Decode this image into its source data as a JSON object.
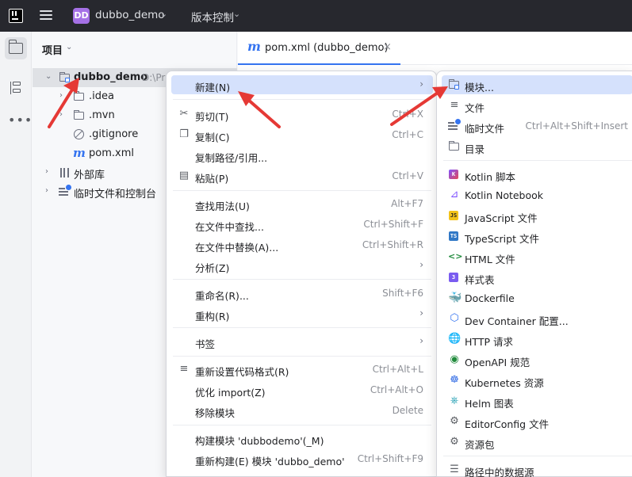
{
  "titlebar": {
    "project_badge": "DD",
    "project_name": "dubbo_demo",
    "vcs_label": "版本控制"
  },
  "project_panel": {
    "title": "项目",
    "tree": [
      {
        "label": "dubbo_demo",
        "hint": "D:\\Pr",
        "icon": "module-folder-icon",
        "expanded": true,
        "selected": true
      },
      {
        "label": ".idea",
        "icon": "folder-icon"
      },
      {
        "label": ".mvn",
        "icon": "folder-icon"
      },
      {
        "label": ".gitignore",
        "icon": "ignored-file-icon"
      },
      {
        "label": "pom.xml",
        "icon": "maven-icon"
      },
      {
        "label": "外部库",
        "icon": "library-icon"
      },
      {
        "label": "临时文件和控制台",
        "icon": "scratch-icon"
      }
    ]
  },
  "editor": {
    "tab_label": "pom.xml (dubbo_demo)",
    "tab_close": "×"
  },
  "context_menu": {
    "items": [
      {
        "label": "新建(N)",
        "shortcut": "",
        "submenu": true
      },
      {
        "label": "剪切(T)",
        "shortcut": "Ctrl+X",
        "icon": "cut-icon"
      },
      {
        "label": "复制(C)",
        "shortcut": "Ctrl+C",
        "icon": "copy-icon"
      },
      {
        "label": "复制路径/引用...",
        "shortcut": ""
      },
      {
        "label": "粘贴(P)",
        "shortcut": "Ctrl+V",
        "icon": "paste-icon"
      },
      {
        "label": "查找用法(U)",
        "shortcut": "Alt+F7"
      },
      {
        "label": "在文件中查找...",
        "shortcut": "Ctrl+Shift+F"
      },
      {
        "label": "在文件中替换(A)...",
        "shortcut": "Ctrl+Shift+R"
      },
      {
        "label": "分析(Z)",
        "shortcut": "",
        "submenu": true
      },
      {
        "label": "重命名(R)...",
        "shortcut": "Shift+F6"
      },
      {
        "label": "重构(R)",
        "shortcut": "",
        "submenu": true
      },
      {
        "label": "书签",
        "shortcut": "",
        "submenu": true
      },
      {
        "label": "重新设置代码格式(R)",
        "shortcut": "Ctrl+Alt+L",
        "icon": "reformat-icon"
      },
      {
        "label": "优化 import(Z)",
        "shortcut": "Ctrl+Alt+O"
      },
      {
        "label": "移除模块",
        "shortcut": "Delete"
      },
      {
        "label": "构建模块 'dubbodemo'(_M)",
        "shortcut": ""
      },
      {
        "label": "重新构建(E) 模块 'dubbo_demo'",
        "shortcut": "Ctrl+Shift+F9"
      }
    ],
    "submenu_chevron": "›"
  },
  "new_submenu": {
    "items": [
      {
        "label": "模块...",
        "shortcut": "",
        "icon": "module-icon"
      },
      {
        "label": "文件",
        "shortcut": "",
        "icon": "file-icon"
      },
      {
        "label": "临时文件",
        "shortcut": "Ctrl+Alt+Shift+Insert",
        "icon": "scratch-file-icon"
      },
      {
        "label": "目录",
        "shortcut": "",
        "icon": "directory-icon"
      },
      {
        "label": "Kotlin 脚本",
        "shortcut": "",
        "icon": "kotlin-icon"
      },
      {
        "label": "Kotlin Notebook",
        "shortcut": "",
        "icon": "kotlin-notebook-icon"
      },
      {
        "label": "JavaScript 文件",
        "shortcut": "",
        "icon": "javascript-icon"
      },
      {
        "label": "TypeScript 文件",
        "shortcut": "",
        "icon": "typescript-icon"
      },
      {
        "label": "HTML 文件",
        "shortcut": "",
        "icon": "html-icon"
      },
      {
        "label": "样式表",
        "shortcut": "",
        "icon": "css-icon"
      },
      {
        "label": "Dockerfile",
        "shortcut": "",
        "icon": "docker-icon"
      },
      {
        "label": "Dev Container 配置...",
        "shortcut": "",
        "icon": "dev-container-icon"
      },
      {
        "label": "HTTP 请求",
        "shortcut": "",
        "icon": "http-icon"
      },
      {
        "label": "OpenAPI 规范",
        "shortcut": "",
        "icon": "openapi-icon"
      },
      {
        "label": "Kubernetes 资源",
        "shortcut": "",
        "icon": "kubernetes-icon"
      },
      {
        "label": "Helm 图表",
        "shortcut": "",
        "icon": "helm-icon"
      },
      {
        "label": "EditorConfig 文件",
        "shortcut": "",
        "icon": "editorconfig-icon"
      },
      {
        "label": "资源包",
        "shortcut": "",
        "icon": "resource-bundle-icon"
      },
      {
        "label": "路径中的数据源",
        "shortcut": "",
        "icon": "datasource-icon"
      }
    ]
  },
  "icons": {
    "kotlin": "K",
    "js": "JS",
    "ts": "TS",
    "html": "<>",
    "css": "3"
  },
  "colors": {
    "titlebar_bg": "#27282e",
    "accent": "#3574f0",
    "highlight": "#d5e1fc",
    "annotation": "#e53935",
    "project_badge": "#a571e6"
  }
}
